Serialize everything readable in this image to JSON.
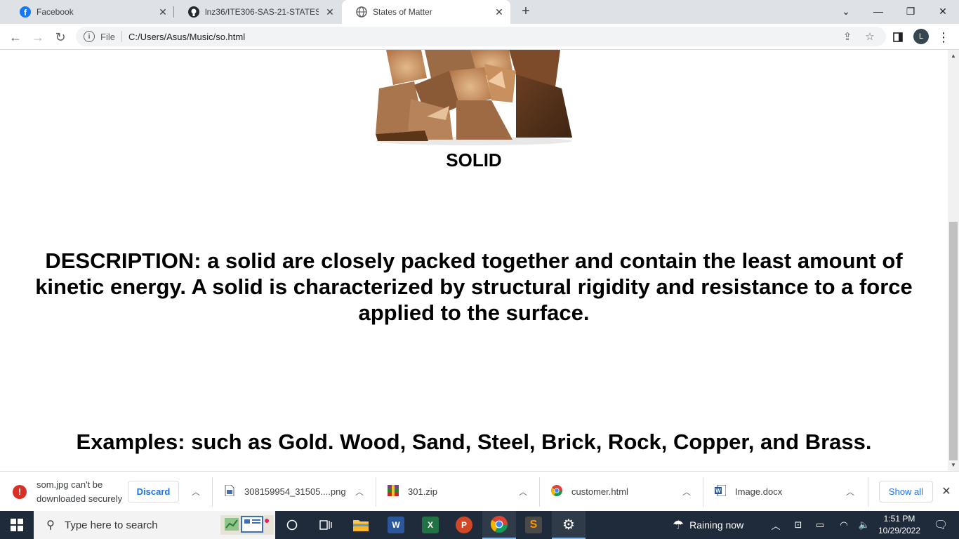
{
  "browser": {
    "tabs": [
      {
        "title": "Facebook",
        "icon": "facebook-icon"
      },
      {
        "title": "lnz36/ITE306-SAS-21-STATES-OF",
        "icon": "github-icon"
      },
      {
        "title": "States of Matter",
        "icon": "globe-icon"
      }
    ],
    "address_scheme": "File",
    "address_url": "C:/Users/Asus/Music/so.html",
    "profile_initial": "L"
  },
  "page": {
    "heading": "SOLID",
    "description": "DESCRIPTION: a solid are closely packed together and contain the least amount of kinetic energy. A solid is characterized by structural rigidity and resistance to a force applied to the surface.",
    "examples": "Examples: such as Gold. Wood, Sand, Steel, Brick, Rock, Copper, and Brass."
  },
  "downloads": {
    "warning_line1": "som.jpg can't be",
    "warning_line2": "downloaded securely",
    "discard_label": "Discard",
    "items": [
      {
        "name": "308159954_31505....png",
        "icon": "png-file-icon"
      },
      {
        "name": "301.zip",
        "icon": "zip-file-icon"
      },
      {
        "name": "customer.html",
        "icon": "chrome-html-icon"
      },
      {
        "name": "Image.docx",
        "icon": "word-file-icon"
      }
    ],
    "show_all_label": "Show all"
  },
  "taskbar": {
    "search_placeholder": "Type here to search",
    "weather": "Raining now",
    "time": "1:51 PM",
    "date": "10/29/2022"
  }
}
